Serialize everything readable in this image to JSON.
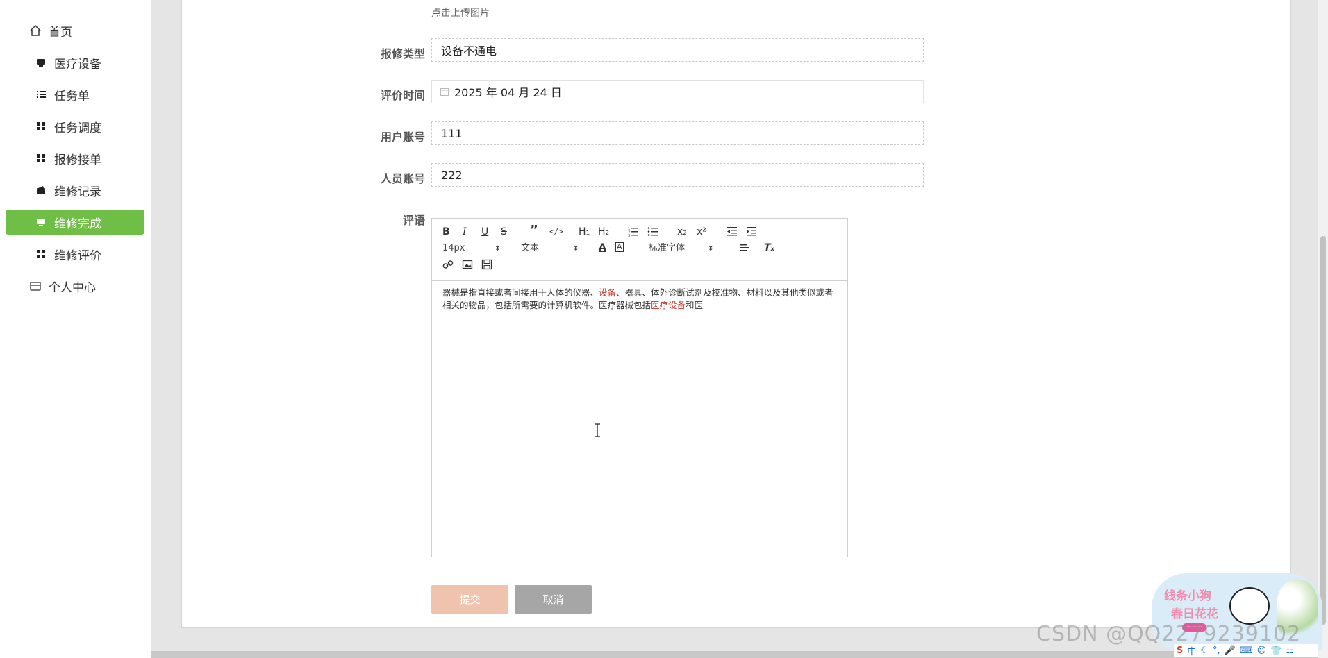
{
  "sidebar": {
    "items": [
      {
        "label": "首页",
        "icon": "home-icon"
      },
      {
        "label": "医疗设备",
        "icon": "monitor-icon"
      },
      {
        "label": "任务单",
        "icon": "list-icon"
      },
      {
        "label": "任务调度",
        "icon": "grid-icon"
      },
      {
        "label": "报修接单",
        "icon": "grid-icon"
      },
      {
        "label": "维修记录",
        "icon": "wallet-icon"
      },
      {
        "label": "维修完成",
        "icon": "monitor-icon",
        "active": true
      },
      {
        "label": "维修评价",
        "icon": "grid-icon"
      },
      {
        "label": "个人中心",
        "icon": "card-icon"
      }
    ],
    "active_color": "#6fbe45"
  },
  "form": {
    "upload_hint": "点击上传图片",
    "repair_type": {
      "label": "报修类型",
      "value": "设备不通电"
    },
    "eval_time": {
      "label": "评价时间",
      "value": "2025 年 04 月 24 日"
    },
    "user_account": {
      "label": "用户账号",
      "value": "111"
    },
    "staff_account": {
      "label": "人员账号",
      "value": "222"
    },
    "comment": {
      "label": "评语",
      "text_part1": "器械是指直接或者间接用于人体的仪器、",
      "text_red1": "设备",
      "text_part2": "、器具、体外诊断试剂及校准物、材料以及其他类似或者相关的物品，包括所需要的计算机软件。医疗器械包括",
      "text_red2": "医疗设备",
      "text_part3": "和医"
    },
    "submit_label": "提交",
    "cancel_label": "取消"
  },
  "editor_toolbar": {
    "font_size": "14px",
    "paragraph": "文本",
    "font_family": "标准字体",
    "h1": "H₁",
    "h2": "H₂",
    "sub": "x₂",
    "sup": "x²"
  },
  "overlay": {
    "watermark": "CSDN @QQ2279239102",
    "sticker_line1": "线条小狗",
    "sticker_line2": "春日花花",
    "ime_char": "中"
  }
}
